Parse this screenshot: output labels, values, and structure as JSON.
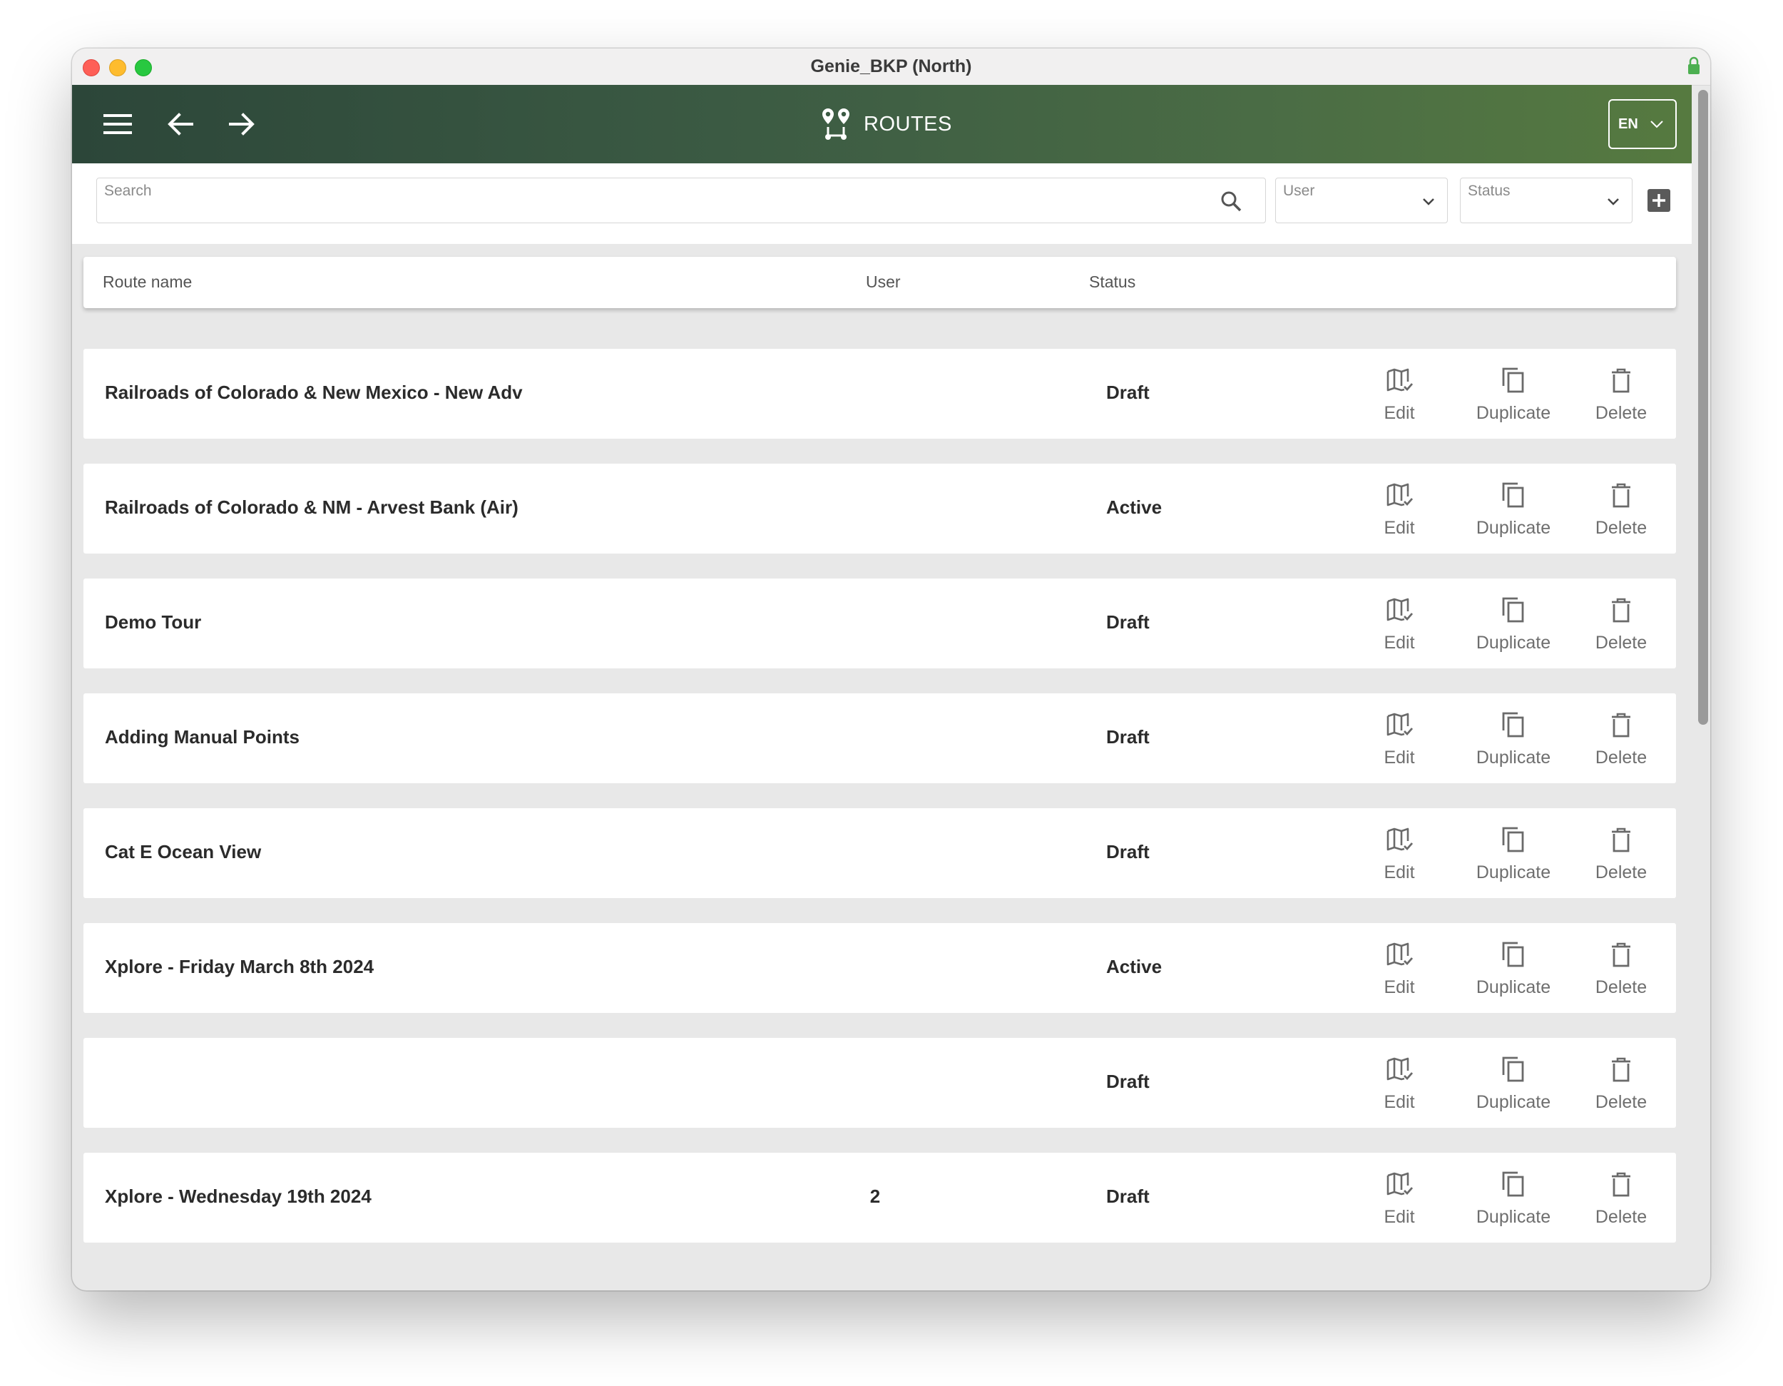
{
  "window": {
    "title": "Genie_BKP (North)"
  },
  "appbar": {
    "title": "ROUTES",
    "language": "EN"
  },
  "filters": {
    "search_placeholder": "Search",
    "user_label": "User",
    "status_label": "Status"
  },
  "table": {
    "headers": {
      "route_name": "Route name",
      "user": "User",
      "status": "Status"
    },
    "actions": {
      "edit": "Edit",
      "duplicate": "Duplicate",
      "delete": "Delete"
    },
    "rows": [
      {
        "name": "Railroads of Colorado & New Mexico - New Adv",
        "user": "",
        "status": "Draft"
      },
      {
        "name": "Railroads of Colorado & NM - Arvest Bank (Air)",
        "user": "",
        "status": "Active"
      },
      {
        "name": "Demo Tour",
        "user": "",
        "status": "Draft"
      },
      {
        "name": "Adding Manual Points",
        "user": "",
        "status": "Draft"
      },
      {
        "name": "Cat E Ocean View",
        "user": "",
        "status": "Draft"
      },
      {
        "name": "Xplore - Friday March 8th 2024",
        "user": "",
        "status": "Active"
      },
      {
        "name": "",
        "user": "",
        "status": "Draft"
      },
      {
        "name": "Xplore - Wednesday 19th 2024",
        "user": "2",
        "status": "Draft"
      }
    ]
  },
  "icons": {
    "menu": "hamburger-icon",
    "back": "arrow-left-icon",
    "forward": "arrow-right-icon",
    "routes": "route-icon",
    "search": "search-icon",
    "dropdown": "chevron-down-icon",
    "add": "plus-square-icon",
    "edit": "map-check-icon",
    "duplicate": "copy-icon",
    "delete": "trash-icon",
    "lock": "lock-icon"
  },
  "colors": {
    "header_gradient_start": "#2c4639",
    "header_gradient_end": "#567a40",
    "background": "#e8e8e8",
    "row_background": "#ffffff"
  }
}
